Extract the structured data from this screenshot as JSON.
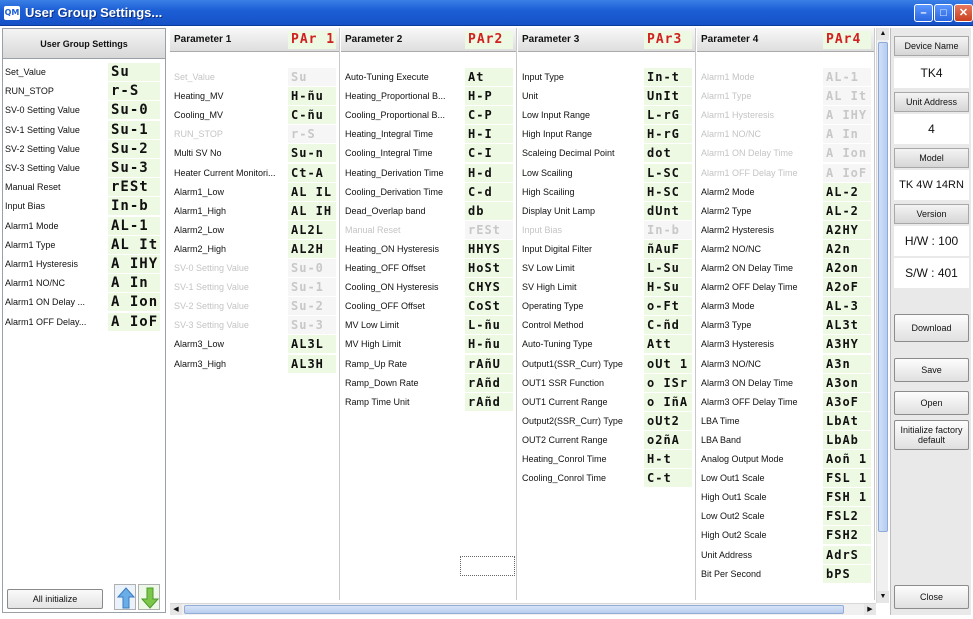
{
  "window": {
    "title": "User Group Settings...",
    "app_icon": "QM"
  },
  "left": {
    "header": "User Group Settings",
    "rows": [
      {
        "label": "Set_Value",
        "seg": "Su"
      },
      {
        "label": "RUN_STOP",
        "seg": "r-S"
      },
      {
        "label": "SV-0 Setting Value",
        "seg": "Su-0"
      },
      {
        "label": "SV-1 Setting Value",
        "seg": "Su-1"
      },
      {
        "label": "SV-2 Setting Value",
        "seg": "Su-2"
      },
      {
        "label": "SV-3 Setting Value",
        "seg": "Su-3"
      },
      {
        "label": "Manual Reset",
        "seg": "rESt"
      },
      {
        "label": "Input Bias",
        "seg": "In-b"
      },
      {
        "label": "Alarm1 Mode",
        "seg": "AL-1"
      },
      {
        "label": "Alarm1 Type",
        "seg": "AL It"
      },
      {
        "label": "Alarm1 Hysteresis",
        "seg": "A IHY"
      },
      {
        "label": "Alarm1 NO/NC",
        "seg": "A In"
      },
      {
        "label": "Alarm1 ON Delay ...",
        "seg": "A Ion"
      },
      {
        "label": "Alarm1 OFF Delay...",
        "seg": "A IoF"
      }
    ],
    "all_initialize": "All initialize"
  },
  "columns": [
    {
      "title": "Parameter 1",
      "seg": "PAr 1",
      "rows": [
        {
          "label": "Set_Value",
          "seg": "Su",
          "disabled": true
        },
        {
          "label": "Heating_MV",
          "seg": "H-ñu"
        },
        {
          "label": "Cooling_MV",
          "seg": "C-ñu"
        },
        {
          "label": "RUN_STOP",
          "seg": "r-S",
          "disabled": true
        },
        {
          "label": "Multi SV No",
          "seg": "Su-n"
        },
        {
          "label": "Heater Current Monitori...",
          "seg": "Ct-A"
        },
        {
          "label": "Alarm1_Low",
          "seg": "AL IL"
        },
        {
          "label": "Alarm1_High",
          "seg": "AL IH"
        },
        {
          "label": "Alarm2_Low",
          "seg": "AL2L"
        },
        {
          "label": "Alarm2_High",
          "seg": "AL2H"
        },
        {
          "label": "SV-0 Setting Value",
          "seg": "Su-0",
          "disabled": true
        },
        {
          "label": "SV-1 Setting Value",
          "seg": "Su-1",
          "disabled": true
        },
        {
          "label": "SV-2 Setting Value",
          "seg": "Su-2",
          "disabled": true
        },
        {
          "label": "SV-3 Setting Value",
          "seg": "Su-3",
          "disabled": true
        },
        {
          "label": "Alarm3_Low",
          "seg": "AL3L"
        },
        {
          "label": "Alarm3_High",
          "seg": "AL3H"
        }
      ]
    },
    {
      "title": "Parameter 2",
      "seg": "PAr2",
      "rows": [
        {
          "label": "Auto-Tuning Execute",
          "seg": "At"
        },
        {
          "label": "Heating_Proportional B...",
          "seg": "H-P"
        },
        {
          "label": "Cooling_Proportional B...",
          "seg": "C-P"
        },
        {
          "label": "Heating_Integral Time",
          "seg": "H-I"
        },
        {
          "label": "Cooling_Integral Time",
          "seg": "C-I"
        },
        {
          "label": "Heating_Derivation Time",
          "seg": "H-d"
        },
        {
          "label": "Cooling_Derivation Time",
          "seg": "C-d"
        },
        {
          "label": "Dead_Overlap band",
          "seg": "db"
        },
        {
          "label": "Manual Reset",
          "seg": "rESt",
          "disabled": true
        },
        {
          "label": "Heating_ON Hysteresis",
          "seg": "HHYS"
        },
        {
          "label": "Heating_OFF Offset",
          "seg": "HoSt"
        },
        {
          "label": "Cooling_ON Hysteresis",
          "seg": "CHYS"
        },
        {
          "label": "Cooling_OFF Offset",
          "seg": "CoSt"
        },
        {
          "label": "MV Low Limit",
          "seg": "L-ñu"
        },
        {
          "label": "MV High Limit",
          "seg": "H-ñu"
        },
        {
          "label": "Ramp_Up Rate",
          "seg": "rAñU"
        },
        {
          "label": "Ramp_Down Rate",
          "seg": "rAñd"
        },
        {
          "label": "Ramp Time Unit",
          "seg": "rAñd"
        }
      ]
    },
    {
      "title": "Parameter 3",
      "seg": "PAr3",
      "rows": [
        {
          "label": "Input Type",
          "seg": "In-t"
        },
        {
          "label": "Unit",
          "seg": "UnIt"
        },
        {
          "label": "Low Input Range",
          "seg": "L-rG"
        },
        {
          "label": "High Input Range",
          "seg": "H-rG"
        },
        {
          "label": "Scaleing Decimal Point",
          "seg": "dot"
        },
        {
          "label": "Low Scailing",
          "seg": "L-SC"
        },
        {
          "label": "High Scailing",
          "seg": "H-SC"
        },
        {
          "label": "Display Unit Lamp",
          "seg": "dUnt"
        },
        {
          "label": "Input Bias",
          "seg": "In-b",
          "disabled": true
        },
        {
          "label": "Input Digital Filter",
          "seg": "ñAuF"
        },
        {
          "label": "SV Low Limit",
          "seg": "L-Su"
        },
        {
          "label": "SV High Limit",
          "seg": "H-Su"
        },
        {
          "label": "Operating Type",
          "seg": "o-Ft"
        },
        {
          "label": "Control Method",
          "seg": "C-ñd"
        },
        {
          "label": "Auto-Tuning Type",
          "seg": "Att"
        },
        {
          "label": "Output1(SSR_Curr) Type",
          "seg": "oUt 1"
        },
        {
          "label": "OUT1 SSR Function",
          "seg": "o ISr"
        },
        {
          "label": "OUT1 Current Range",
          "seg": "o IñA"
        },
        {
          "label": "Output2(SSR_Curr) Type",
          "seg": "oUt2"
        },
        {
          "label": "OUT2 Current Range",
          "seg": "o2ñA"
        },
        {
          "label": "Heating_Conrol Time",
          "seg": "H-t"
        },
        {
          "label": "Cooling_Conrol Time",
          "seg": "C-t"
        }
      ]
    },
    {
      "title": "Parameter 4",
      "seg": "PAr4",
      "rows": [
        {
          "label": "Alarm1 Mode",
          "seg": "AL-1",
          "disabled": true
        },
        {
          "label": "Alarm1 Type",
          "seg": "AL It",
          "disabled": true
        },
        {
          "label": "Alarm1 Hysteresis",
          "seg": "A IHY",
          "disabled": true
        },
        {
          "label": "Alarm1 NO/NC",
          "seg": "A In",
          "disabled": true
        },
        {
          "label": "Alarm1 ON Delay Time",
          "seg": "A Ion",
          "disabled": true
        },
        {
          "label": "Alarm1 OFF Delay Time",
          "seg": "A IoF",
          "disabled": true
        },
        {
          "label": "Alarm2 Mode",
          "seg": "AL-2"
        },
        {
          "label": "Alarm2 Type",
          "seg": "AL-2"
        },
        {
          "label": "Alarm2 Hysteresis",
          "seg": "A2HY"
        },
        {
          "label": "Alarm2 NO/NC",
          "seg": "A2n"
        },
        {
          "label": "Alarm2 ON Delay Time",
          "seg": "A2on"
        },
        {
          "label": "Alarm2 OFF Delay Time",
          "seg": "A2oF"
        },
        {
          "label": "Alarm3 Mode",
          "seg": "AL-3"
        },
        {
          "label": "Alarm3 Type",
          "seg": "AL3t"
        },
        {
          "label": "Alarm3 Hysteresis",
          "seg": "A3HY"
        },
        {
          "label": "Alarm3 NO/NC",
          "seg": "A3n"
        },
        {
          "label": "Alarm3 ON Delay Time",
          "seg": "A3on"
        },
        {
          "label": "Alarm3 OFF Delay Time",
          "seg": "A3oF"
        },
        {
          "label": "LBA Time",
          "seg": "LbAt"
        },
        {
          "label": "LBA Band",
          "seg": "LbAb"
        },
        {
          "label": "Analog Output Mode",
          "seg": "Aoñ 1"
        },
        {
          "label": "Low Out1 Scale",
          "seg": "FSL 1"
        },
        {
          "label": "High Out1 Scale",
          "seg": "FSH 1"
        },
        {
          "label": "Low Out2 Scale",
          "seg": "FSL2"
        },
        {
          "label": "High Out2 Scale",
          "seg": "FSH2"
        },
        {
          "label": "Unit Address",
          "seg": "AdrS"
        },
        {
          "label": "Bit Per Second",
          "seg": "bPS"
        }
      ]
    }
  ],
  "right": {
    "device_name_label": "Device Name",
    "device_name": "TK4",
    "unit_address_label": "Unit Address",
    "unit_address": "4",
    "model_label": "Model",
    "model": "TK 4W 14RN",
    "version_label": "Version",
    "hw": "H/W : 100",
    "sw": "S/W : 401",
    "download": "Download",
    "save": "Save",
    "open": "Open",
    "init_factory": "Initialize factory default",
    "close": "Close"
  }
}
